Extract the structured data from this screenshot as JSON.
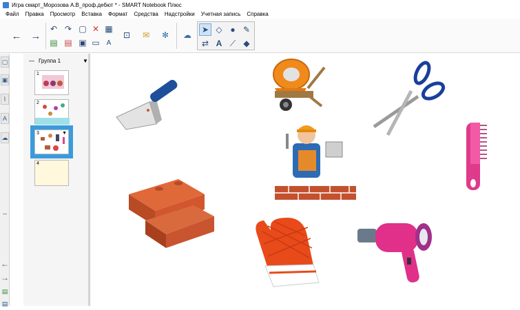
{
  "window": {
    "title": "Игра смарт_Морозова А.В_проф.дебют * - SMART Notebook Плюс"
  },
  "menu": {
    "items": [
      "Файл",
      "Правка",
      "Просмотр",
      "Вставка",
      "Формат",
      "Средства",
      "Надстройки",
      "Учетная запись",
      "Справка"
    ]
  },
  "sorter": {
    "group_label": "Группа 1",
    "pages": [
      {
        "num": "1"
      },
      {
        "num": "2"
      },
      {
        "num": "3"
      },
      {
        "num": "4"
      }
    ]
  },
  "colors": {
    "selection": "#3a9bdc",
    "page4_bg": "#fff8dc"
  }
}
